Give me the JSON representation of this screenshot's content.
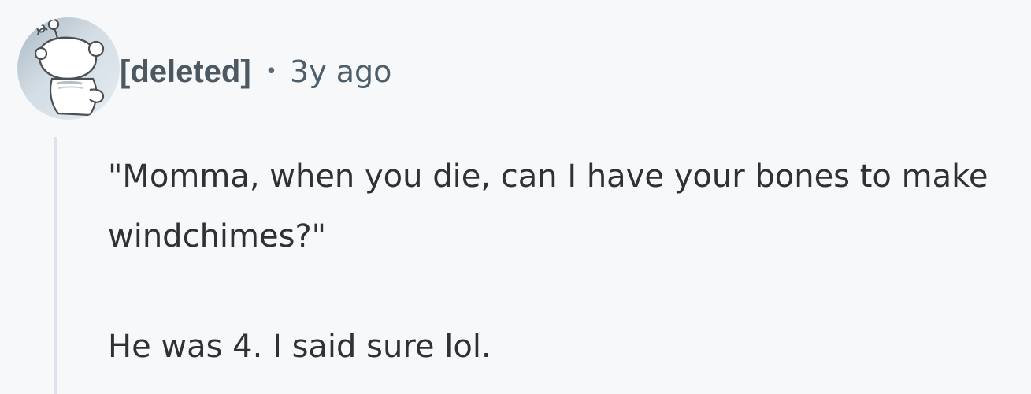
{
  "comment": {
    "author": "[deleted]",
    "separator": "•",
    "timestamp": "3y ago",
    "avatar_icon": "reddit-snoo-avatar-icon",
    "paragraphs": [
      "\"Momma, when you die, can I have your bones to make windchimes?\"",
      "He was 4. I said sure lol."
    ]
  },
  "colors": {
    "background": "#f7f8fa",
    "thread_line": "#dde3ea",
    "author": "#4c5862",
    "text": "#2c3236"
  }
}
